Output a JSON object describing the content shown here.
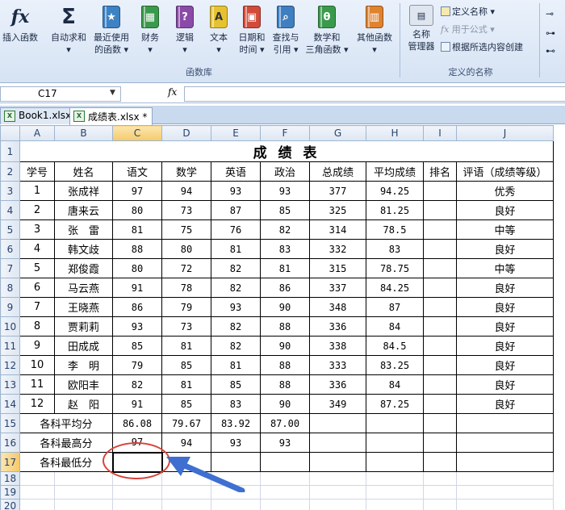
{
  "ribbon": {
    "insert_function": "插入函数",
    "autosum": "自动求和",
    "recent": [
      "最近使用",
      "的函数"
    ],
    "finance": "财务",
    "logic": "逻辑",
    "text": "文本",
    "datetime": [
      "日期和",
      "时间"
    ],
    "lookup": [
      "查找与",
      "引用"
    ],
    "math": [
      "数学和",
      "三角函数"
    ],
    "other": "其他函数",
    "library_label": "函数库",
    "name_manager": [
      "名称",
      "管理器"
    ],
    "define_name": "定义名称",
    "use_in_formula": "用于公式",
    "create_from_selection": "根据所选内容创建",
    "defined_names_label": "定义的名称"
  },
  "formula_bar": {
    "name_box": "C17",
    "fx": "fx",
    "content": ""
  },
  "tabs": [
    "Book1.xlsx",
    "成绩表.xlsx *"
  ],
  "columns": [
    "A",
    "B",
    "C",
    "D",
    "E",
    "F",
    "G",
    "H",
    "I",
    "J"
  ],
  "rows": [
    "1",
    "2",
    "3",
    "4",
    "5",
    "6",
    "7",
    "8",
    "9",
    "10",
    "11",
    "12",
    "13",
    "14",
    "15",
    "16",
    "17",
    "18",
    "19",
    "20"
  ],
  "sheet": {
    "title": "成 绩 表",
    "headers": [
      "学号",
      "姓名",
      "语文",
      "数学",
      "英语",
      "政治",
      "总成绩",
      "平均成绩",
      "排名",
      "评语（成绩等级）"
    ],
    "students": [
      [
        "1",
        "张成祥",
        "97",
        "94",
        "93",
        "93",
        "377",
        "94.25",
        "",
        "优秀"
      ],
      [
        "2",
        "唐来云",
        "80",
        "73",
        "87",
        "85",
        "325",
        "81.25",
        "",
        "良好"
      ],
      [
        "3",
        "张　雷",
        "81",
        "75",
        "76",
        "82",
        "314",
        "78.5",
        "",
        "中等"
      ],
      [
        "4",
        "韩文歧",
        "88",
        "80",
        "81",
        "83",
        "332",
        "83",
        "",
        "良好"
      ],
      [
        "5",
        "郑俊霞",
        "80",
        "72",
        "82",
        "81",
        "315",
        "78.75",
        "",
        "中等"
      ],
      [
        "6",
        "马云燕",
        "91",
        "78",
        "82",
        "86",
        "337",
        "84.25",
        "",
        "良好"
      ],
      [
        "7",
        "王晓燕",
        "86",
        "79",
        "93",
        "90",
        "348",
        "87",
        "",
        "良好"
      ],
      [
        "8",
        "贾莉莉",
        "93",
        "73",
        "82",
        "88",
        "336",
        "84",
        "",
        "良好"
      ],
      [
        "9",
        "田成成",
        "85",
        "81",
        "82",
        "90",
        "338",
        "84.5",
        "",
        "良好"
      ],
      [
        "10",
        "李　明",
        "79",
        "85",
        "81",
        "88",
        "333",
        "83.25",
        "",
        "良好"
      ],
      [
        "11",
        "欧阳丰",
        "82",
        "81",
        "85",
        "88",
        "336",
        "84",
        "",
        "良好"
      ],
      [
        "12",
        "赵　阳",
        "91",
        "85",
        "83",
        "90",
        "349",
        "87.25",
        "",
        "良好"
      ]
    ],
    "avg_label": "各科平均分",
    "avg": [
      "86.08",
      "79.67",
      "83.92",
      "87.00"
    ],
    "max_label": "各科最高分",
    "max": [
      "97",
      "94",
      "93",
      "93"
    ],
    "min_label": "各科最低分"
  }
}
